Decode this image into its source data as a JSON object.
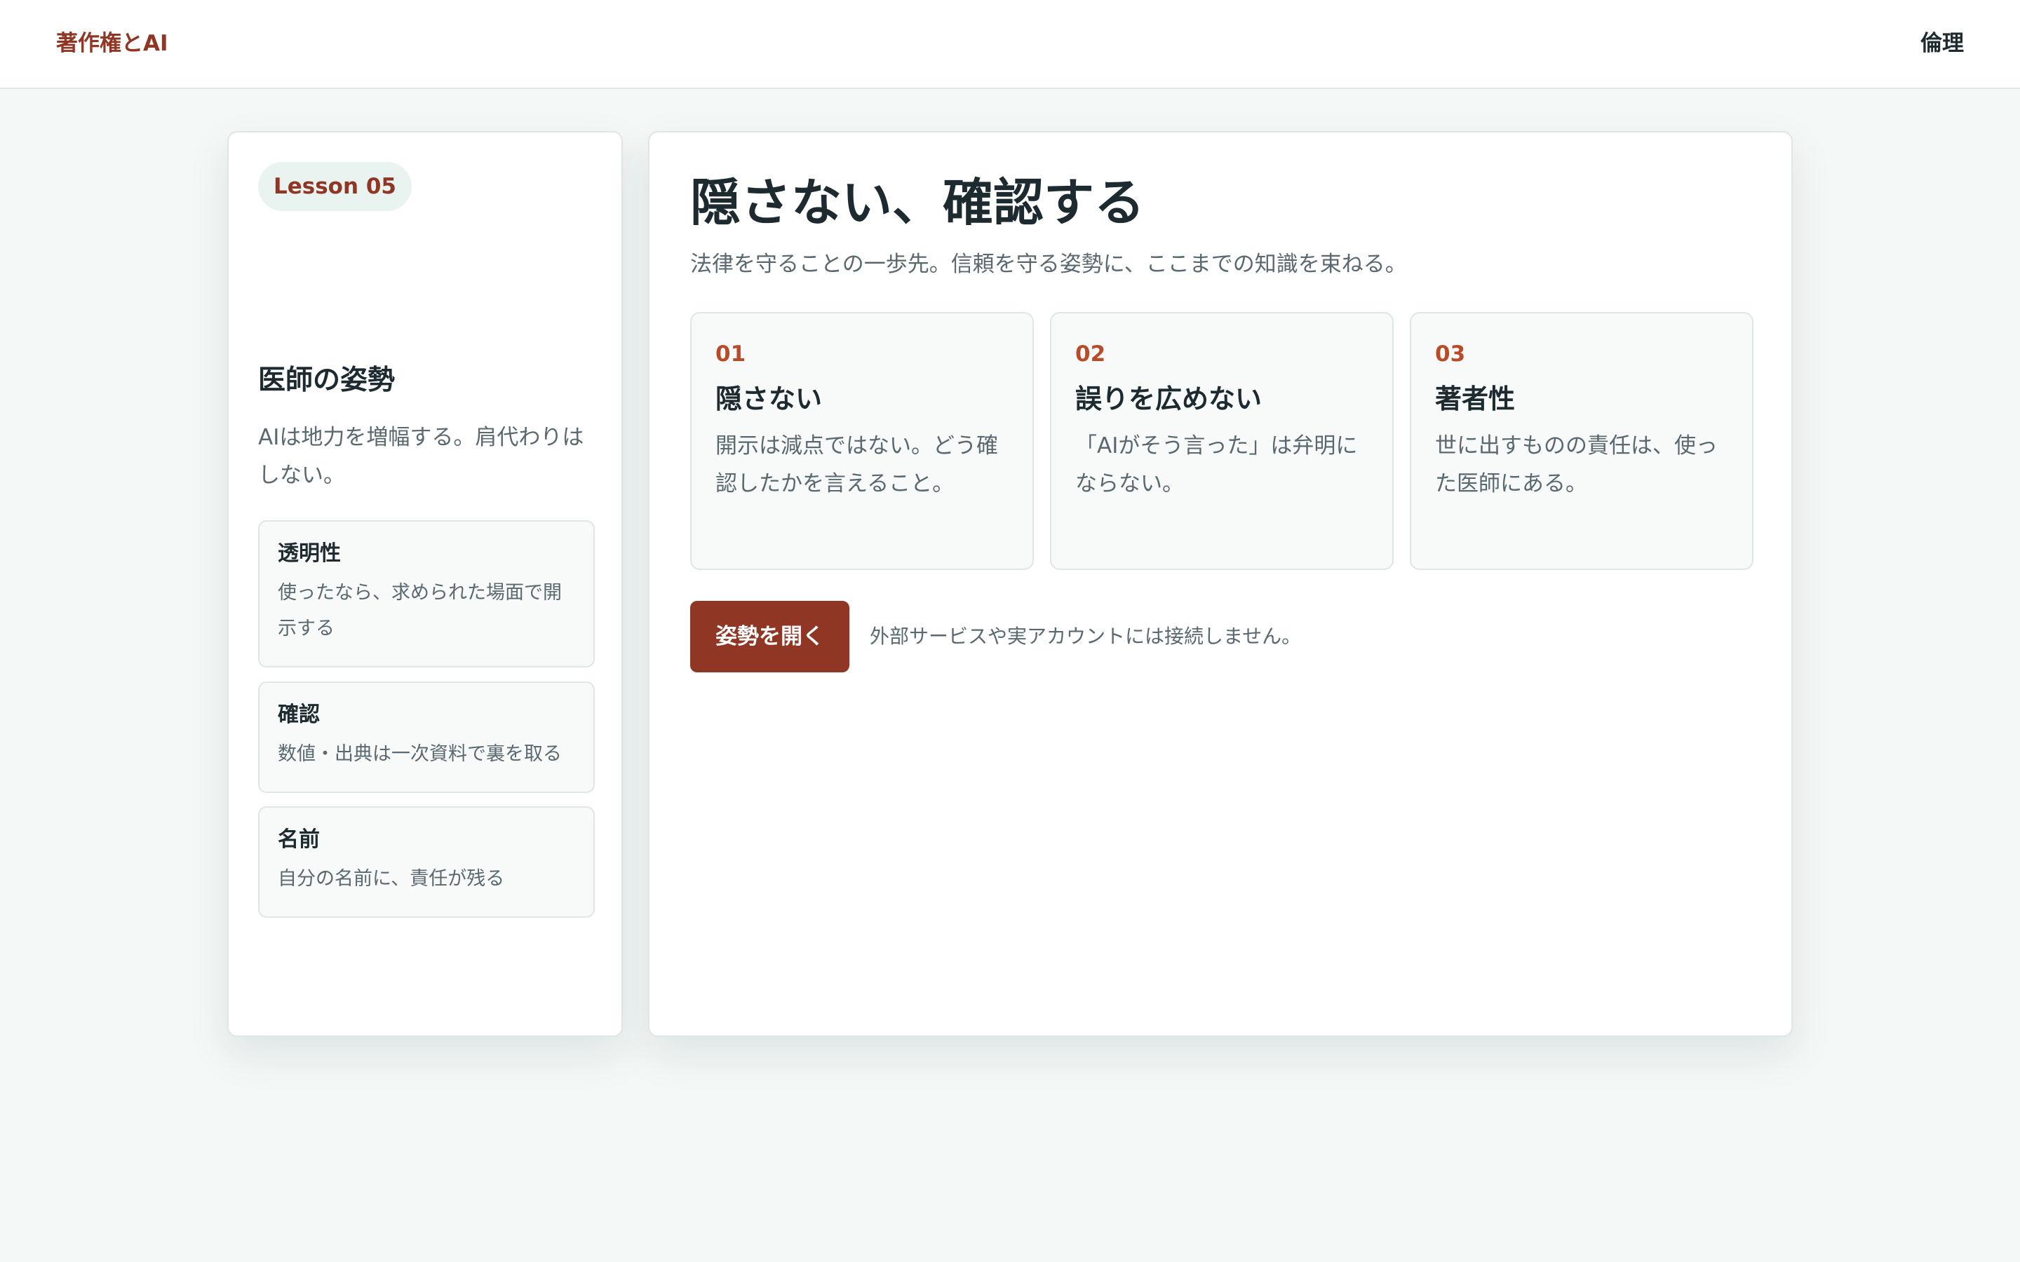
{
  "header": {
    "brand": "著作権とAI",
    "nav_link": "倫理"
  },
  "sidebar": {
    "lesson_badge": "Lesson 05",
    "title": "医師の姿勢",
    "description": "AIは地力を増幅する。肩代わりはしない。",
    "cards": [
      {
        "title": "透明性",
        "text": "使ったなら、求められた場面で開示する"
      },
      {
        "title": "確認",
        "text": "数値・出典は一次資料で裏を取る"
      },
      {
        "title": "名前",
        "text": "自分の名前に、責任が残る"
      }
    ]
  },
  "main": {
    "title": "隠さない、確認する",
    "lead": "法律を守ることの一歩先。信頼を守る姿勢に、ここまでの知識を束ねる。",
    "points": [
      {
        "number": "01",
        "title": "隠さない",
        "text": "開示は減点ではない。どう確認したかを言えること。"
      },
      {
        "number": "02",
        "title": "誤りを広めない",
        "text": "「AIがそう言った」は弁明にならない。"
      },
      {
        "number": "03",
        "title": "著者性",
        "text": "世に出すものの責任は、使った医師にある。"
      }
    ],
    "cta_label": "姿勢を開く",
    "cta_note": "外部サービスや実アカウントには接続しません。"
  },
  "colors": {
    "accent": "#8f3624",
    "number_accent": "#b84c2a",
    "page_bg": "#f4f8f7",
    "badge_bg": "#e9f4f1"
  }
}
